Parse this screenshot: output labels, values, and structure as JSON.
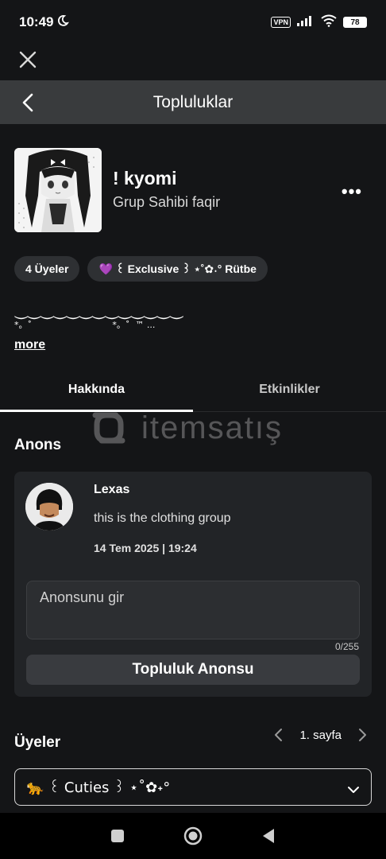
{
  "status_bar": {
    "time": "10:49",
    "moon_icon": "moon-icon",
    "vpn_label": "VPN",
    "battery_level": "78"
  },
  "header": {
    "title": "Topluluklar"
  },
  "group": {
    "name": "! kyomi",
    "owner_label": "Grup Sahibi faqir",
    "more_label": "•••",
    "chips": [
      {
        "label": "4 Üyeler"
      },
      {
        "label": "💜 ꒰ Exclusive ꒱ ⋆˚✿˖° Rütbe"
      }
    ],
    "description_line1": "⏝⏝⏝⏝⏝⏝⏝⏝⏝⏝⏝⏝⏝",
    "description_line2": "*。˚                             *。˚  ™ ...",
    "more_link": "more"
  },
  "tabs": [
    {
      "label": "Hakkında",
      "active": true
    },
    {
      "label": "Etkinlikler",
      "active": false
    }
  ],
  "watermark": {
    "text": "itemsatış"
  },
  "announcements": {
    "heading": "Anons",
    "author": "Lexas",
    "message": "this is the clothing group",
    "timestamp": "14 Tem 2025 | 19:24",
    "input_placeholder": "Anonsunu gir",
    "char_count": "0/255",
    "submit_label": "Topluluk Anonsu"
  },
  "members": {
    "heading": "Üyeler",
    "page_label": "1. sayfa",
    "dropdown_value": "🐆 ꒰ Cuties ꒱ ⋆˚✿˖°"
  },
  "colors": {
    "background": "#141517",
    "titlebar": "#393b3d",
    "card": "#222427",
    "chip": "#2e3033"
  }
}
